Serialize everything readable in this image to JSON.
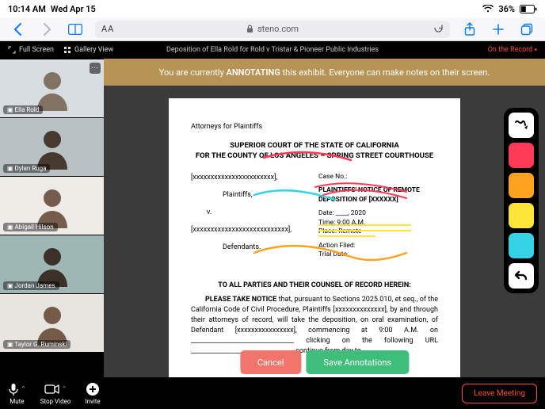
{
  "status": {
    "time": "10:14 AM",
    "date": "Wed Apr 15",
    "battery": "36%"
  },
  "safari": {
    "host": "steno.com"
  },
  "appbar": {
    "fullscreen": "Full Screen",
    "gallery": "Gallery View",
    "title": "Deposition of Ella Rold for Rold v Tristar & Pioneer Public Industries",
    "record": "On the Record"
  },
  "banner": {
    "pre": "You are currently ",
    "strong": "ANNOTATING",
    "post": " this exhibit. Everyone can make notes on their screen."
  },
  "participants": [
    {
      "name": "Ella Rold",
      "bg": "#d7dde1",
      "fg": "#7a6a5a"
    },
    {
      "name": "Dylan Ruga",
      "bg": "#b8c2c4",
      "fg": "#3d2e22"
    },
    {
      "name": "Abigail Hilson",
      "bg": "#efece8",
      "fg": "#6b5140"
    },
    {
      "name": "Jordan James",
      "bg": "#9fb7b4",
      "fg": "#33261d"
    },
    {
      "name": "Taylor G. Ruminski",
      "bg": "#e8e5e0",
      "fg": "#6a4f3d"
    }
  ],
  "tools": {
    "colors": [
      "#ff3a57",
      "#ffa21f",
      "#ffe43a",
      "#35d2e6"
    ]
  },
  "actions": {
    "cancel": "Cancel",
    "save": "Save Annotations"
  },
  "bottom": {
    "mute": "Mute",
    "stop": "Stop Video",
    "invite": "Invite",
    "leave": "Leave Meeting"
  },
  "document": {
    "attorneys": "Attorneys for Plaintiffs",
    "court1": "SUPERIOR COURT OF THE STATE OF CALIFORNIA",
    "court2": "FOR THE COUNTY OF LOS ANGELES – SPRING STREET COURTHOUSE",
    "left": {
      "party1": "[xxxxxxxxxxxxxxxxxxxxxxx],",
      "plaintiffs": "Plaintiffs,",
      "v": "v.",
      "party2": "[xxxxxxxxxxxxxxxxxxxxxxxxxxx],",
      "defendants": "Defendants."
    },
    "right": {
      "caseno": "Case No.:",
      "pn1": "PLAINTIFFS' NOTICE OF REMOTE",
      "pn2": "DEPOSITION OF [XXXXXX]",
      "date": "Date:   ____, 2020",
      "time": "Time:   9:00 A.M.",
      "place": "Place:   Remote",
      "action": "Action Filed:",
      "trial": "Trial Date:"
    },
    "noticeHeading": "TO ALL PARTIES AND THEIR COUNSEL OF RECORD HEREIN:",
    "noticeBodyLead": "PLEASE TAKE NOTICE",
    "noticeBody": " that, pursuant to Sections 2025.010, et seq., of the California Code of Civil Procedure, Plaintiffs [xxxxxxxxxxxxxx], by and through their attorneys of record, will take the deposition, on oral examination, of Defendant [xxxxxxxxxxxxxxxx], commencing at 9:00 A.M. on ________________________________ clicking on the following URL ________________________________ continue from day to"
  }
}
